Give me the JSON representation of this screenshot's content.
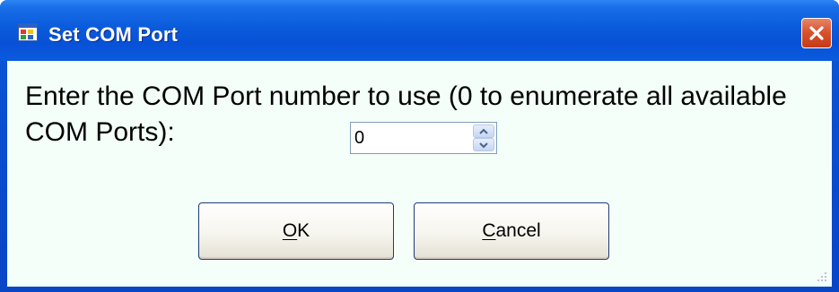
{
  "window": {
    "title": "Set COM Port",
    "close_icon": "close-icon",
    "app_icon": "window-app-icon"
  },
  "dialog": {
    "prompt": "Enter the COM Port number to use (0 to enumerate all available COM Ports):",
    "port_number": {
      "value": "0",
      "up_icon": "chevron-up-icon",
      "down_icon": "chevron-down-icon"
    },
    "ok_label_access": "O",
    "ok_label_rest": "K",
    "cancel_label_access": "C",
    "cancel_label_rest": "ancel"
  },
  "colors": {
    "titlebar": "#0a5bdc",
    "client_bg": "#f4fff9",
    "close_button": "#d9532f",
    "button_border": "#1f3a7a"
  }
}
